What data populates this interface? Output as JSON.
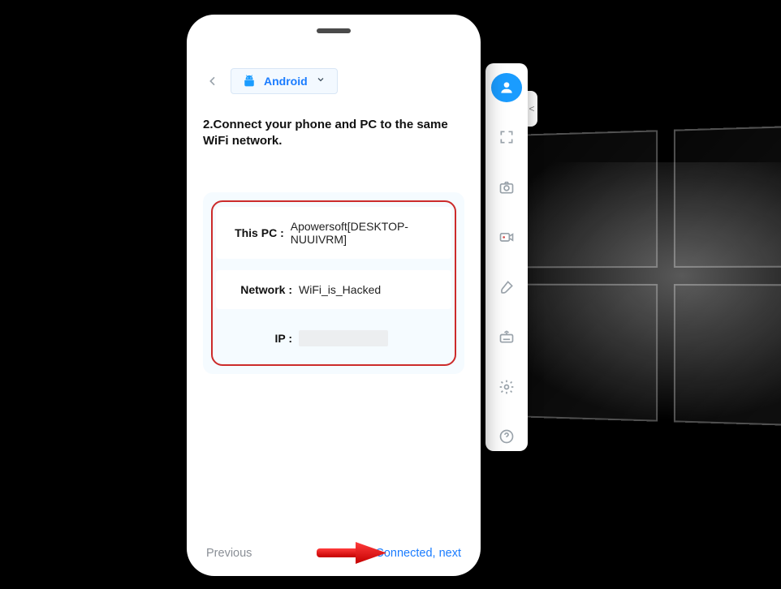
{
  "header": {
    "os_label": "Android"
  },
  "instruction": "2.Connect your phone and PC to the same WiFi network.",
  "info": {
    "pc_label": "This PC  :",
    "pc_value": "Apowersoft[DESKTOP-NUUIVRM]",
    "network_label": "Network :",
    "network_value": "WiFi_is_Hacked",
    "ip_label": "IP   :"
  },
  "nav": {
    "previous": "Previous",
    "next": "Connected, next"
  },
  "toolbar": {
    "expand_hint": "<"
  }
}
